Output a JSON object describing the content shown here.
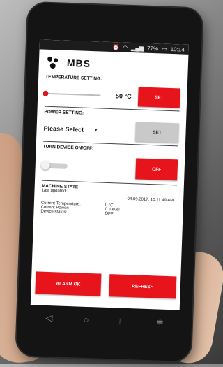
{
  "status_bar": {
    "battery": "77%",
    "time": "10:14"
  },
  "app": {
    "logo_text": "MBS"
  },
  "temperature": {
    "label": "TEMPERATURE SETTING:",
    "value": "50 °C",
    "slider_level": 0,
    "set_label": "SET"
  },
  "power": {
    "label": "POWER SETTING:",
    "selected": "Please Select",
    "set_label": "SET"
  },
  "device": {
    "label": "TURN DEVICE ON/OFF:",
    "toggle_on": false,
    "off_label": "OFF"
  },
  "machine_state": {
    "title": "MACHINE STATE",
    "last_updated_label": "Last updated:",
    "last_updated_value": "04.09.2017. 10:11:49 AM",
    "current_temperature_label": "Current Temperature:",
    "current_temperature_value": "0 °C",
    "current_power_label": "Current Power:",
    "current_power_value": "0. Level",
    "device_status_label": "Device status:",
    "device_status_value": "OFF"
  },
  "actions": {
    "alarm_ok": "ALARM OK",
    "refresh": "REFRESH"
  },
  "colors": {
    "accent": "#e8141b",
    "disabled": "#c9c9c9"
  },
  "icons": [
    "alarm-icon",
    "wifi-icon",
    "signal-icon",
    "battery-icon",
    "back-icon",
    "home-icon",
    "recents-icon",
    "menu-icon"
  ]
}
